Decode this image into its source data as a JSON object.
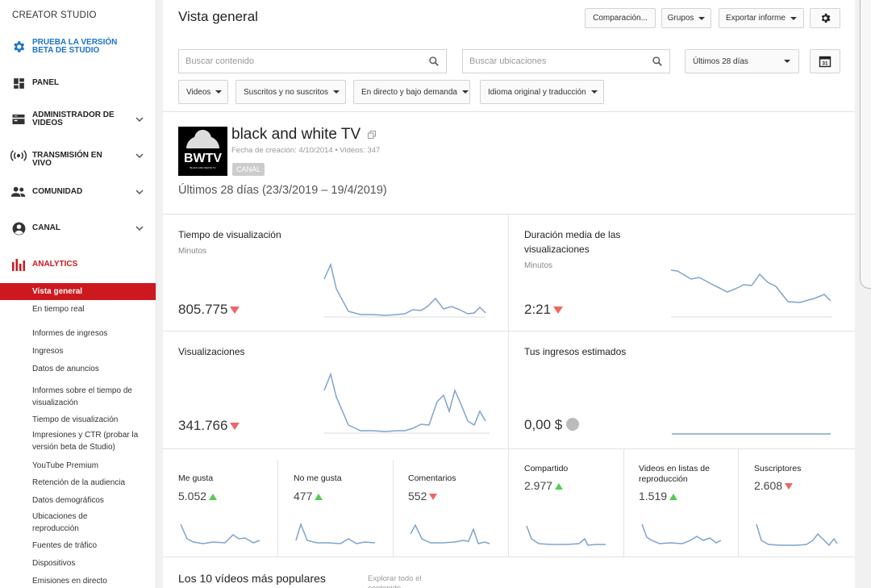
{
  "sidebar": {
    "brand": "CREATOR STUDIO",
    "beta_label": "PRUEBA LA VERSIÓN BETA DE STUDIO",
    "nav": [
      {
        "id": "panel",
        "label": "PANEL",
        "icon": "dashboard-icon"
      },
      {
        "id": "video-manager",
        "label": "ADMINISTRADOR DE VIDEOS",
        "icon": "video-manager-icon"
      },
      {
        "id": "live",
        "label": "TRANSMISIÓN EN VIVO",
        "icon": "broadcast-icon"
      },
      {
        "id": "community",
        "label": "COMUNIDAD",
        "icon": "people-icon"
      },
      {
        "id": "channel",
        "label": "CANAL",
        "icon": "account-icon"
      },
      {
        "id": "analytics",
        "label": "ANALYTICS",
        "icon": "analytics-icon"
      }
    ],
    "analytics_items": [
      "Vista general",
      "En tiempo real",
      "Informes de ingresos",
      "Ingresos",
      "Datos de anuncios",
      "Informes sobre el tiempo de visualización",
      "Tiempo de visualización",
      "Impresiones y CTR (probar la versión beta de Studio)",
      "YouTube Premium",
      "Retención de la audiencia",
      "Datos demográficos",
      "Ubicaciones de reproducción",
      "Fuentes de tráfico",
      "Dispositivos",
      "Emisiones en directo"
    ]
  },
  "header": {
    "title": "Vista general",
    "compare_label": "Comparación...",
    "groups_label": "Grupos",
    "export_label": "Exportar informe"
  },
  "search": {
    "content_placeholder": "Buscar contenido",
    "locations_placeholder": "Buscar ubicaciones",
    "date_range": "Últimos 28 días",
    "calendar_day": "31"
  },
  "filters": {
    "videos": "Videos",
    "subscribers": "Suscritos y no suscritos",
    "live_mode": "En directo y bajo demanda",
    "language": "Idioma original y traducción"
  },
  "channel": {
    "name": "black and white TV",
    "meta": "Fecha de creación: 4/10/2014 • Videos: 347",
    "badge": "CANAL",
    "logo_text": "BWTV",
    "logo_subtext": "BLACK AND WHITE TV",
    "period": "Últimos 28 días (23/3/2019 – 19/4/2019)"
  },
  "metrics": {
    "watch_time": {
      "title": "Tiempo de visualización",
      "unit": "Minutos",
      "value": "805.775",
      "trend": "down"
    },
    "avg_duration": {
      "title": "Duración media de las visualizaciones",
      "unit": "Minutos",
      "value": "2:21",
      "trend": "down"
    },
    "views": {
      "title": "Visualizaciones",
      "value": "341.766",
      "trend": "down"
    },
    "revenue": {
      "title": "Tus ingresos estimados",
      "value": "0,00 $"
    }
  },
  "small_metrics": [
    {
      "label": "Me gusta",
      "value": "5.052",
      "trend": "up"
    },
    {
      "label": "No me gusta",
      "value": "477",
      "trend": "up"
    },
    {
      "label": "Comentarios",
      "value": "552",
      "trend": "down"
    },
    {
      "label": "Compartido",
      "value": "2.977",
      "trend": "up"
    },
    {
      "label": "Videos en listas de reproducción",
      "value": "1.519",
      "trend": "up"
    },
    {
      "label": "Suscriptores",
      "value": "2.608",
      "trend": "down"
    }
  ],
  "bottom": {
    "top_videos": "Los 10 vídeos más populares",
    "explore_all": "Explorar todo el contenido"
  },
  "colors": {
    "accent": "#cc181e",
    "spark": "#7ea3cf",
    "up": "#55cc55",
    "down": "#ee6666",
    "beta": "#1a73c8"
  }
}
